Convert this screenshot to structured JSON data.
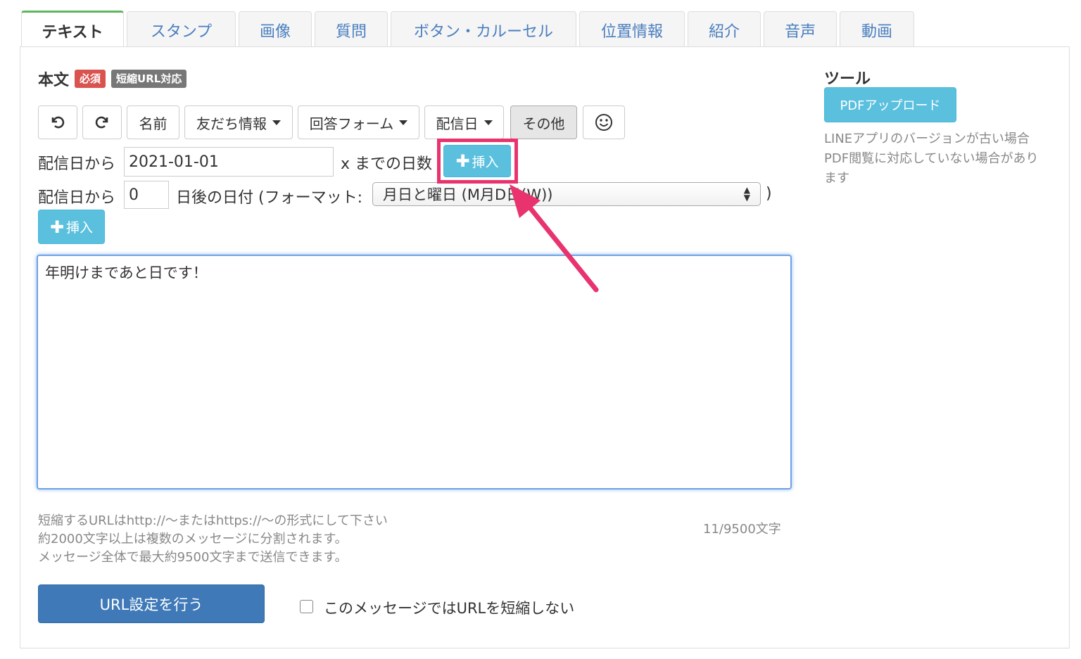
{
  "tabs": [
    {
      "label": "テキスト",
      "active": true
    },
    {
      "label": "スタンプ",
      "active": false
    },
    {
      "label": "画像",
      "active": false
    },
    {
      "label": "質問",
      "active": false
    },
    {
      "label": "ボタン・カルーセル",
      "active": false
    },
    {
      "label": "位置情報",
      "active": false
    },
    {
      "label": "紹介",
      "active": false
    },
    {
      "label": "音声",
      "active": false
    },
    {
      "label": "動画",
      "active": false
    }
  ],
  "body_section": {
    "title": "本文",
    "required_badge": "必須",
    "short_url_badge": "短縮URL対応"
  },
  "toolbar": {
    "undo_icon": "undo-icon",
    "redo_icon": "redo-icon",
    "name_label": "名前",
    "friend_info_label": "友だち情報",
    "answer_form_label": "回答フォーム",
    "delivery_date_label": "配信日",
    "other_label": "その他",
    "emoji_icon": "smiley-icon"
  },
  "days_until": {
    "prefix": "配信日から",
    "date_value": "2021-01-01",
    "suffix": "x までの日数",
    "insert_label": "挿入"
  },
  "days_after": {
    "prefix": "配信日から",
    "offset_value": "0",
    "middle": "日後の日付 (フォーマット:",
    "format_selected": "月日と曜日 (M月D日(W))",
    "close_paren": ")",
    "insert_label": "挿入"
  },
  "message": {
    "text": "年明けまであと日です！"
  },
  "help_lines": [
    "短縮するURLはhttp://〜またはhttps://〜の形式にして下さい",
    "約2000文字以上は複数のメッセージに分割されます。",
    "メッセージ全体で最大約9500文字まで送信できます。"
  ],
  "char_count": "11/9500文字",
  "url_settings_button": "URL設定を行う",
  "no_shorten_checkbox": {
    "label": "このメッセージではURLを短縮しない",
    "checked": false
  },
  "tools": {
    "title": "ツール",
    "pdf_upload_label": "PDFアップロード",
    "description": "LINEアプリのバージョンが古い場合PDF閲覧に対応していない場合があります"
  },
  "colors": {
    "info": "#5bc0de",
    "primary": "#3f79b8",
    "danger_badge": "#d9534f",
    "highlight": "#e8336e",
    "active_tab_top": "#5cb85c"
  }
}
